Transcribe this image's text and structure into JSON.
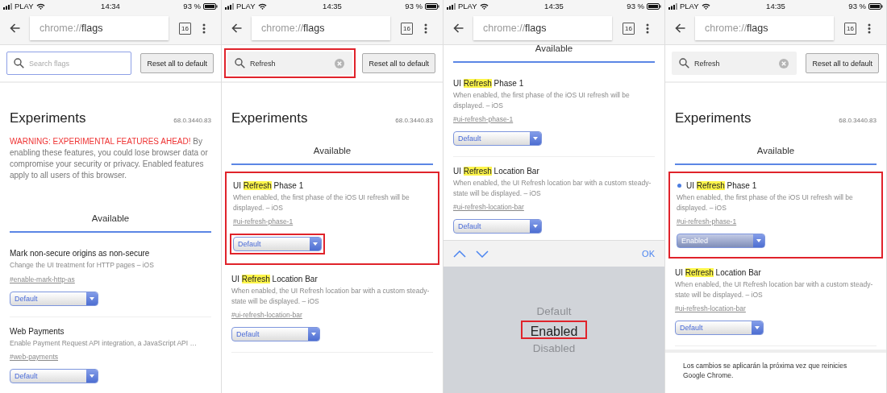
{
  "panels": [
    {
      "status": {
        "carrier": "PLAY",
        "time": "14:34",
        "battery": "93 %"
      },
      "toolbar": {
        "url_scheme": "chrome://",
        "url_host": "flags",
        "tab_count": "16"
      },
      "search": {
        "placeholder": "Search flags",
        "focused": true,
        "annotated": false
      },
      "reset_button": "Reset all to default",
      "header": {
        "title": "Experiments",
        "version": "68.0.3440.83",
        "warning": "WARNING: EXPERIMENTAL FEATURES AHEAD!",
        "notice": "By enabling these features, you could lose browser data or compromise your security or privacy. Enabled features apply to all users of this browser."
      },
      "section_title": "Available",
      "flags": [
        {
          "title": [
            {
              "text": "Mark non-secure origins as non-secure",
              "match": false
            }
          ],
          "description": "Change the UI treatment for HTTP pages – iOS",
          "link": "#enable-mark-http-as",
          "value": "Default",
          "modified": false,
          "annotated": false,
          "select_annotated": false
        },
        {
          "title": [
            {
              "text": "Web Payments",
              "match": false
            }
          ],
          "description": "Enable Payment Request API integration, a JavaScript API …",
          "link": "#web-payments",
          "value": "Default",
          "modified": false,
          "annotated": false,
          "select_annotated": false
        }
      ]
    },
    {
      "status": {
        "carrier": "PLAY",
        "time": "14:35",
        "battery": "93 %"
      },
      "toolbar": {
        "url_scheme": "chrome://",
        "url_host": "flags",
        "tab_count": "16"
      },
      "search": {
        "value": "Refresh",
        "focused": false,
        "annotated": true
      },
      "reset_button": "Reset all to default",
      "header": {
        "title": "Experiments",
        "version": "68.0.3440.83"
      },
      "section_title": "Available",
      "flags": [
        {
          "title": [
            {
              "text": "UI ",
              "match": false
            },
            {
              "text": "Refresh",
              "match": true
            },
            {
              "text": " Phase 1",
              "match": false
            }
          ],
          "description": "When enabled, the first phase of the iOS UI refresh will be displayed. – iOS",
          "link": "#ui-refresh-phase-1",
          "value": "Default",
          "modified": false,
          "annotated": true,
          "select_annotated": true
        },
        {
          "title": [
            {
              "text": "UI ",
              "match": false
            },
            {
              "text": "Refresh",
              "match": true
            },
            {
              "text": " Location Bar",
              "match": false
            }
          ],
          "description": "When enabled, the UI Refresh location bar with a custom steady-state will be displayed. – iOS",
          "link": "#ui-refresh-location-bar",
          "value": "Default",
          "modified": false,
          "annotated": false,
          "select_annotated": false
        }
      ]
    },
    {
      "status": {
        "carrier": "PLAY",
        "time": "14:35",
        "battery": "93 %"
      },
      "toolbar": {
        "url_scheme": "chrome://",
        "url_host": "flags",
        "tab_count": "16"
      },
      "section_title": "Available",
      "flags": [
        {
          "title": [
            {
              "text": "UI ",
              "match": false
            },
            {
              "text": "Refresh",
              "match": true
            },
            {
              "text": " Phase 1",
              "match": false
            }
          ],
          "description": "When enabled, the first phase of the iOS UI refresh will be displayed. – iOS",
          "link": "#ui-refresh-phase-1",
          "value": "Default",
          "modified": false,
          "annotated": false,
          "select_annotated": false
        },
        {
          "title": [
            {
              "text": "UI ",
              "match": false
            },
            {
              "text": "Refresh",
              "match": true
            },
            {
              "text": " Location Bar",
              "match": false
            }
          ],
          "description": "When enabled, the UI Refresh location bar with a custom steady-state will be displayed. – iOS",
          "link": "#ui-refresh-location-bar",
          "value": "Default",
          "modified": false,
          "annotated": false,
          "select_annotated": false
        }
      ],
      "picker": {
        "done": "OK",
        "options": [
          {
            "label": "Default",
            "selected": false,
            "annotated": false
          },
          {
            "label": "Enabled",
            "selected": true,
            "annotated": true
          },
          {
            "label": "Disabled",
            "selected": false,
            "annotated": false
          }
        ]
      }
    },
    {
      "status": {
        "carrier": "PLAY",
        "time": "14:35",
        "battery": "93 %"
      },
      "toolbar": {
        "url_scheme": "chrome://",
        "url_host": "flags",
        "tab_count": "16"
      },
      "search": {
        "value": "Refresh",
        "focused": false,
        "annotated": false
      },
      "reset_button": "Reset all to default",
      "header": {
        "title": "Experiments",
        "version": "68.0.3440.83"
      },
      "section_title": "Available",
      "flags": [
        {
          "title": [
            {
              "text": "UI ",
              "match": false
            },
            {
              "text": "Refresh",
              "match": true
            },
            {
              "text": " Phase 1",
              "match": false
            }
          ],
          "description": "When enabled, the first phase of the iOS UI refresh will be displayed. – iOS",
          "link": "#ui-refresh-phase-1",
          "value": "Enabled",
          "modified": true,
          "annotated": true,
          "select_annotated": false
        },
        {
          "title": [
            {
              "text": "UI ",
              "match": false
            },
            {
              "text": "Refresh",
              "match": true
            },
            {
              "text": " Location Bar",
              "match": false
            }
          ],
          "description": "When enabled, the UI Refresh location bar with a custom steady-state will be displayed. – iOS",
          "link": "#ui-refresh-location-bar",
          "value": "Default",
          "modified": false,
          "annotated": false,
          "select_annotated": false
        }
      ],
      "footer": "Los cambios se aplicarán la próxima vez que reinicies Google Chrome."
    }
  ]
}
